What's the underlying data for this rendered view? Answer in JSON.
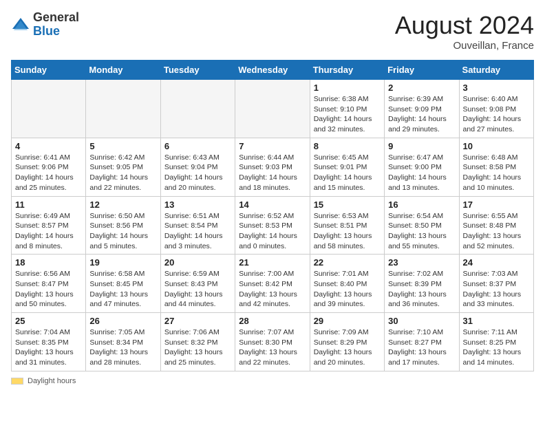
{
  "logo": {
    "general": "General",
    "blue": "Blue"
  },
  "header": {
    "month_year": "August 2024",
    "location": "Ouveillan, France"
  },
  "days_of_week": [
    "Sunday",
    "Monday",
    "Tuesday",
    "Wednesday",
    "Thursday",
    "Friday",
    "Saturday"
  ],
  "footer": {
    "daylight_label": "Daylight hours"
  },
  "weeks": [
    [
      {
        "day": "",
        "info": ""
      },
      {
        "day": "",
        "info": ""
      },
      {
        "day": "",
        "info": ""
      },
      {
        "day": "",
        "info": ""
      },
      {
        "day": "1",
        "info": "Sunrise: 6:38 AM\nSunset: 9:10 PM\nDaylight: 14 hours\nand 32 minutes."
      },
      {
        "day": "2",
        "info": "Sunrise: 6:39 AM\nSunset: 9:09 PM\nDaylight: 14 hours\nand 29 minutes."
      },
      {
        "day": "3",
        "info": "Sunrise: 6:40 AM\nSunset: 9:08 PM\nDaylight: 14 hours\nand 27 minutes."
      }
    ],
    [
      {
        "day": "4",
        "info": "Sunrise: 6:41 AM\nSunset: 9:06 PM\nDaylight: 14 hours\nand 25 minutes."
      },
      {
        "day": "5",
        "info": "Sunrise: 6:42 AM\nSunset: 9:05 PM\nDaylight: 14 hours\nand 22 minutes."
      },
      {
        "day": "6",
        "info": "Sunrise: 6:43 AM\nSunset: 9:04 PM\nDaylight: 14 hours\nand 20 minutes."
      },
      {
        "day": "7",
        "info": "Sunrise: 6:44 AM\nSunset: 9:03 PM\nDaylight: 14 hours\nand 18 minutes."
      },
      {
        "day": "8",
        "info": "Sunrise: 6:45 AM\nSunset: 9:01 PM\nDaylight: 14 hours\nand 15 minutes."
      },
      {
        "day": "9",
        "info": "Sunrise: 6:47 AM\nSunset: 9:00 PM\nDaylight: 14 hours\nand 13 minutes."
      },
      {
        "day": "10",
        "info": "Sunrise: 6:48 AM\nSunset: 8:58 PM\nDaylight: 14 hours\nand 10 minutes."
      }
    ],
    [
      {
        "day": "11",
        "info": "Sunrise: 6:49 AM\nSunset: 8:57 PM\nDaylight: 14 hours\nand 8 minutes."
      },
      {
        "day": "12",
        "info": "Sunrise: 6:50 AM\nSunset: 8:56 PM\nDaylight: 14 hours\nand 5 minutes."
      },
      {
        "day": "13",
        "info": "Sunrise: 6:51 AM\nSunset: 8:54 PM\nDaylight: 14 hours\nand 3 minutes."
      },
      {
        "day": "14",
        "info": "Sunrise: 6:52 AM\nSunset: 8:53 PM\nDaylight: 14 hours\nand 0 minutes."
      },
      {
        "day": "15",
        "info": "Sunrise: 6:53 AM\nSunset: 8:51 PM\nDaylight: 13 hours\nand 58 minutes."
      },
      {
        "day": "16",
        "info": "Sunrise: 6:54 AM\nSunset: 8:50 PM\nDaylight: 13 hours\nand 55 minutes."
      },
      {
        "day": "17",
        "info": "Sunrise: 6:55 AM\nSunset: 8:48 PM\nDaylight: 13 hours\nand 52 minutes."
      }
    ],
    [
      {
        "day": "18",
        "info": "Sunrise: 6:56 AM\nSunset: 8:47 PM\nDaylight: 13 hours\nand 50 minutes."
      },
      {
        "day": "19",
        "info": "Sunrise: 6:58 AM\nSunset: 8:45 PM\nDaylight: 13 hours\nand 47 minutes."
      },
      {
        "day": "20",
        "info": "Sunrise: 6:59 AM\nSunset: 8:43 PM\nDaylight: 13 hours\nand 44 minutes."
      },
      {
        "day": "21",
        "info": "Sunrise: 7:00 AM\nSunset: 8:42 PM\nDaylight: 13 hours\nand 42 minutes."
      },
      {
        "day": "22",
        "info": "Sunrise: 7:01 AM\nSunset: 8:40 PM\nDaylight: 13 hours\nand 39 minutes."
      },
      {
        "day": "23",
        "info": "Sunrise: 7:02 AM\nSunset: 8:39 PM\nDaylight: 13 hours\nand 36 minutes."
      },
      {
        "day": "24",
        "info": "Sunrise: 7:03 AM\nSunset: 8:37 PM\nDaylight: 13 hours\nand 33 minutes."
      }
    ],
    [
      {
        "day": "25",
        "info": "Sunrise: 7:04 AM\nSunset: 8:35 PM\nDaylight: 13 hours\nand 31 minutes."
      },
      {
        "day": "26",
        "info": "Sunrise: 7:05 AM\nSunset: 8:34 PM\nDaylight: 13 hours\nand 28 minutes."
      },
      {
        "day": "27",
        "info": "Sunrise: 7:06 AM\nSunset: 8:32 PM\nDaylight: 13 hours\nand 25 minutes."
      },
      {
        "day": "28",
        "info": "Sunrise: 7:07 AM\nSunset: 8:30 PM\nDaylight: 13 hours\nand 22 minutes."
      },
      {
        "day": "29",
        "info": "Sunrise: 7:09 AM\nSunset: 8:29 PM\nDaylight: 13 hours\nand 20 minutes."
      },
      {
        "day": "30",
        "info": "Sunrise: 7:10 AM\nSunset: 8:27 PM\nDaylight: 13 hours\nand 17 minutes."
      },
      {
        "day": "31",
        "info": "Sunrise: 7:11 AM\nSunset: 8:25 PM\nDaylight: 13 hours\nand 14 minutes."
      }
    ]
  ]
}
